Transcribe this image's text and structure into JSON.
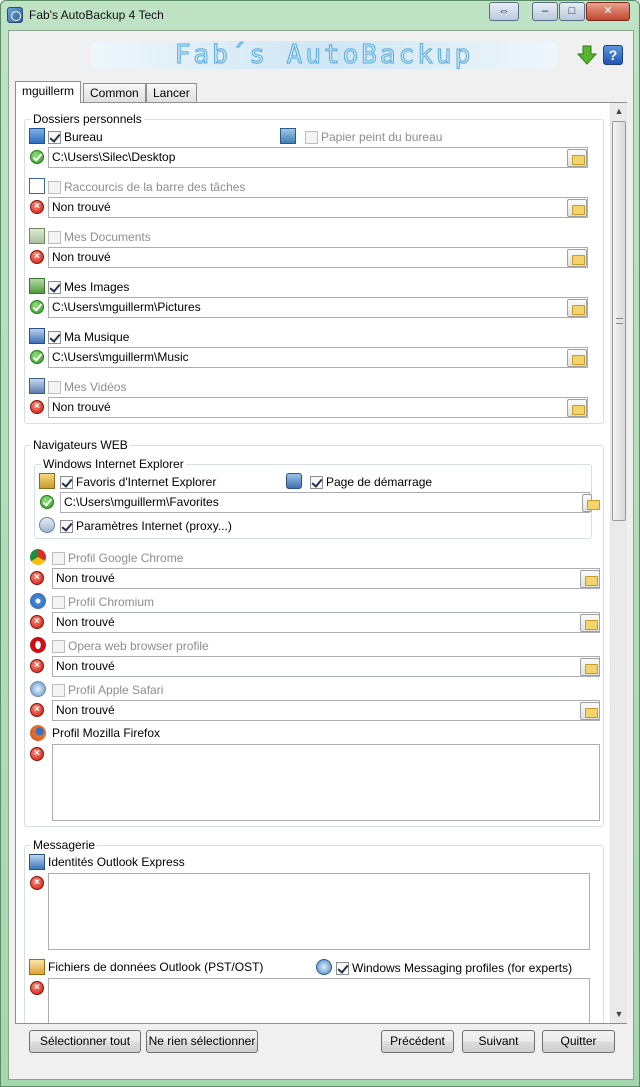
{
  "window": {
    "title": "Fab's AutoBackup 4 Tech"
  },
  "titlebar_buttons": {
    "restore": "⇔",
    "minimize": "–",
    "maximize": "□",
    "close": "✕"
  },
  "banner": {
    "text": "Fab´s AutoBackup"
  },
  "tabs": [
    {
      "label": "mguillerm",
      "active": true
    },
    {
      "label": "Common",
      "active": false
    },
    {
      "label": "Lancer",
      "active": false
    }
  ],
  "personal": {
    "legend": "Dossiers personnels",
    "items": [
      {
        "label": "Bureau",
        "checked": true,
        "enabled": true,
        "status": "ok",
        "path": "C:\\Users\\Silec\\Desktop",
        "extra": {
          "label": "Papier peint du bureau",
          "checked": false,
          "enabled": false
        }
      },
      {
        "label": "Raccourcis de la barre des tâches",
        "checked": false,
        "enabled": false,
        "status": "error",
        "path": "Non trouvé"
      },
      {
        "label": "Mes Documents",
        "checked": false,
        "enabled": false,
        "status": "error",
        "path": "Non trouvé"
      },
      {
        "label": "Mes Images",
        "checked": true,
        "enabled": true,
        "status": "ok",
        "path": "C:\\Users\\mguillerm\\Pictures"
      },
      {
        "label": "Ma Musique",
        "checked": true,
        "enabled": true,
        "status": "ok",
        "path": "C:\\Users\\mguillerm\\Music"
      },
      {
        "label": "Mes Vidéos",
        "checked": false,
        "enabled": false,
        "status": "error",
        "path": "Non trouvé"
      }
    ]
  },
  "web": {
    "legend": "Navigateurs WEB",
    "ie": {
      "legend": "Windows Internet Explorer",
      "favorites_label": "Favoris d'Internet Explorer",
      "homepage_label": "Page de démarrage",
      "path": "C:\\Users\\mguillerm\\Favorites",
      "proxy_label": "Paramètres Internet (proxy...)"
    },
    "browsers": [
      {
        "label": "Profil Google Chrome",
        "path": "Non trouvé"
      },
      {
        "label": "Profil Chromium",
        "path": "Non trouvé"
      },
      {
        "label": "Opera web browser profile",
        "path": "Non trouvé"
      },
      {
        "label": "Profil Apple Safari",
        "path": "Non trouvé"
      }
    ],
    "firefox_label": "Profil Mozilla Firefox"
  },
  "mail": {
    "legend": "Messagerie",
    "outlook_express_label": "Identités Outlook Express",
    "pst_label": "Fichiers de données Outlook (PST/OST)",
    "wms_label": "Windows Messaging profiles (for experts)"
  },
  "buttons": {
    "select_all": "Sélectionner tout",
    "select_none": "Ne rien sélectionner",
    "previous": "Précédent",
    "next": "Suivant",
    "quit": "Quitter"
  },
  "colors": {
    "titlebar": "#a6d6ae",
    "banner_text": "#56a9de",
    "ok": "#2e9a22",
    "error": "#c7180c"
  }
}
